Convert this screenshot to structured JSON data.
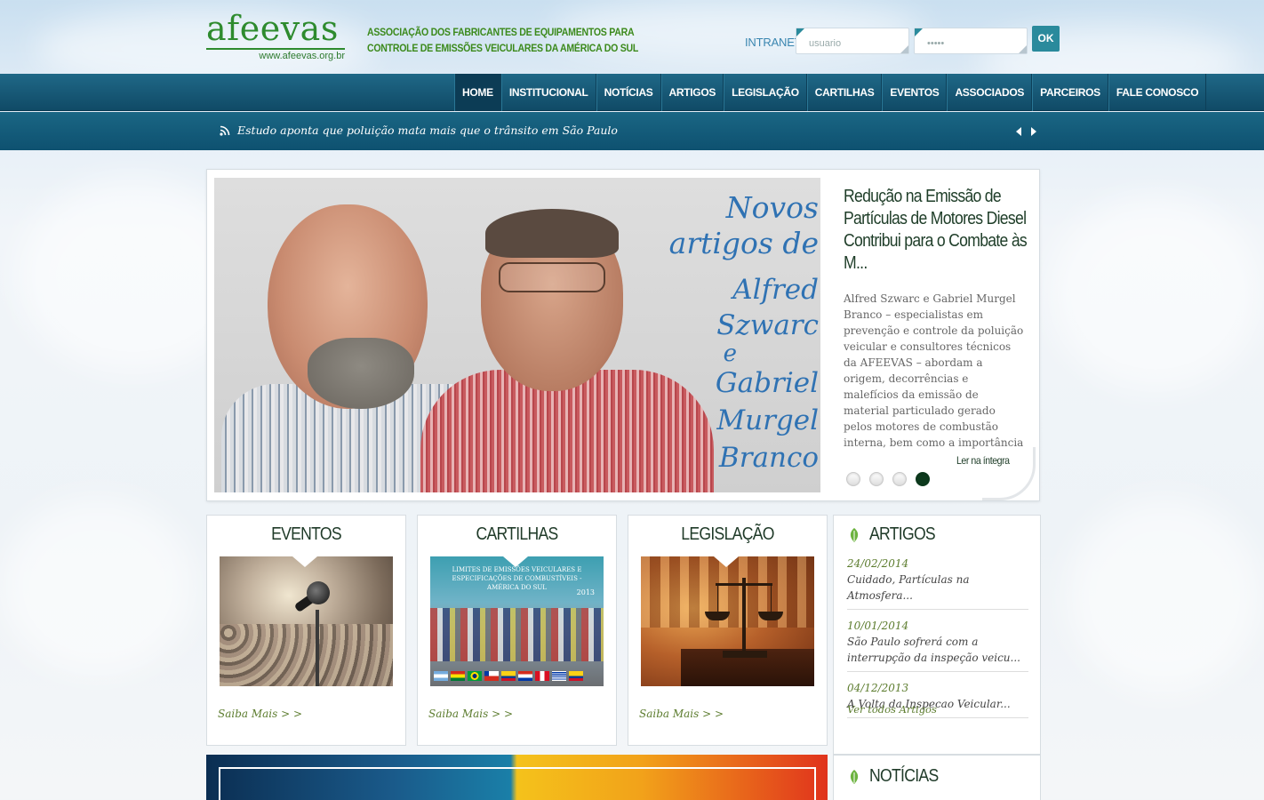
{
  "header": {
    "logo_text": "afeevas",
    "logo_url": "www.afeevas.org.br",
    "tagline_line1": "ASSOCIAÇÃO DOS FABRICANTES DE EQUIPAMENTOS PARA",
    "tagline_line2": "CONTROLE DE EMISSÕES VEICULARES DA AMÉRICA DO SUL",
    "intranet_label": "INTRANET",
    "username_placeholder": "usuario",
    "password_placeholder": "•••••",
    "ok_label": "OK"
  },
  "nav": {
    "items": [
      {
        "label": "HOME",
        "active": true
      },
      {
        "label": "INSTITUCIONAL"
      },
      {
        "label": "NOTÍCIAS"
      },
      {
        "label": "ARTIGOS"
      },
      {
        "label": "LEGISLAÇÃO"
      },
      {
        "label": "CARTILHAS"
      },
      {
        "label": "EVENTOS"
      },
      {
        "label": "ASSOCIADOS"
      },
      {
        "label": "PARCEIROS"
      },
      {
        "label": "FALE CONOSCO"
      }
    ]
  },
  "ticker": {
    "text": "Estudo aponta que poluição mata mais que o trânsito em São Paulo",
    "icon": "rss-icon"
  },
  "feature": {
    "overlay_1": "Novos artigos de",
    "overlay_2": "Alfred Szwarc",
    "overlay_3": "e",
    "overlay_4": "Gabriel Murgel",
    "overlay_5": "Branco",
    "title": "Redução na Emissão de Partículas de Motores Diesel Contribui para o Combate às M...",
    "description": "Alfred Szwarc e Gabriel Murgel Branco –  especialistas em prevenção e controle da poluição veicular e consultores técnicos da AFEEVAS – abordam a origem, decorrências e malefícios da emissão de material particulado gerado pelos motores de combustão interna, bem como a importância de se reduzir a emissão dessas",
    "read_more": "Ler na íntegra",
    "active_dot": 4
  },
  "boxes": [
    {
      "title": "EVENTOS",
      "link": "Saiba Mais > >"
    },
    {
      "title": "CARTILHAS",
      "link": "Saiba Mais > >",
      "image_header": "LIMITES DE EMISSÕES VEICULARES E ESPECIFICAÇÕES DE COMBUSTÍVEIS - AMÉRICA DO SUL",
      "image_year": "2013"
    },
    {
      "title": "LEGISLAÇÃO",
      "link": "Saiba Mais > >"
    }
  ],
  "artigos": {
    "title": "ARTIGOS",
    "items": [
      {
        "date": "24/02/2014",
        "title": "Cuidado, Partículas na Atmosfera..."
      },
      {
        "date": "10/01/2014",
        "title": "São Paulo sofrerá com a interrupção da inspeção veicu..."
      },
      {
        "date": "04/12/2013",
        "title": "A Volta da Inspecao Veicular..."
      }
    ],
    "see_all": "Ver todos Artigos"
  },
  "noticias": {
    "title": "NOTÍCIAS"
  },
  "colors": {
    "brand_green": "#2e8b2e",
    "nav_blue": "#104a66",
    "accent_teal": "#2a8a9c",
    "active_dot": "#0d3a1d"
  }
}
